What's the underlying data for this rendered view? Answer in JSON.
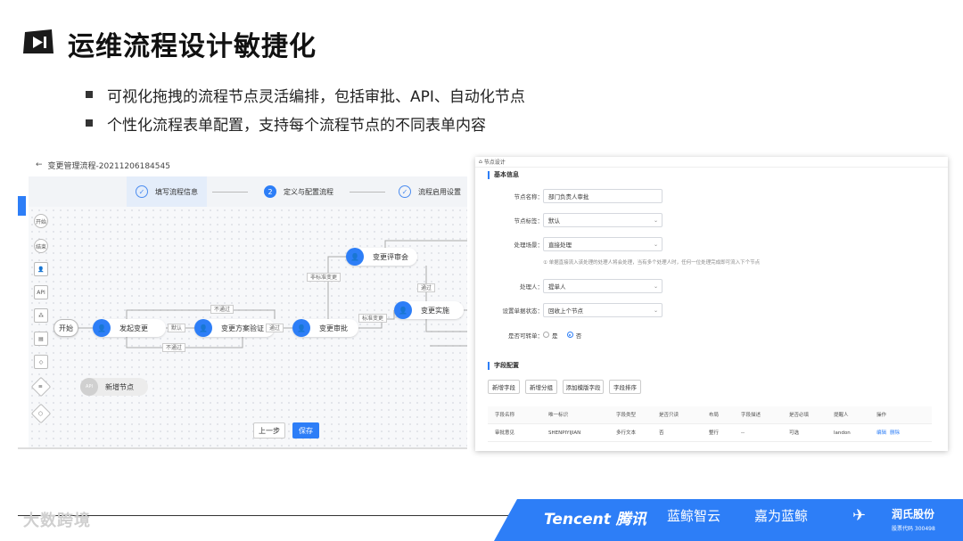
{
  "slide": {
    "title": "运维流程设计敏捷化",
    "bullets": [
      "可视化拖拽的流程节点灵活编排，包括审批、API、自动化节点",
      "个性化流程表单配置，支持每个流程节点的不同表单内容"
    ]
  },
  "flow_editor": {
    "header": "变更管理流程-20211206184545",
    "steps": [
      {
        "num": "✓",
        "label": "填写流程信息"
      },
      {
        "num": "2",
        "label": "定义与配置流程"
      },
      {
        "num": "✓",
        "label": "流程启用设置"
      }
    ],
    "palette": [
      "开始",
      "结束",
      "人",
      "API",
      "⁂",
      "▤",
      "◇",
      "≡",
      "◇"
    ],
    "nodes": {
      "start": "开始",
      "initiate": "发起变更",
      "verify": "变更方案验证",
      "approve": "变更审批",
      "review": "变更评审会",
      "implement": "变更实施"
    },
    "edge_labels": {
      "reject_top": "不通过",
      "default": "默认",
      "reject_bottom": "不通过",
      "pass1": "通过",
      "normal_change": "非标准变更",
      "pass2": "通过",
      "standard_change": "标准变更"
    },
    "new_node": {
      "badge": "API",
      "label": "新增节点"
    },
    "buttons": {
      "prev": "上一步",
      "save": "保存"
    }
  },
  "node_settings": {
    "breadcrumb": "节点设计",
    "section_basic": "基本信息",
    "fields": [
      {
        "label": "节点名称：",
        "value": "部门负责人审批",
        "type": "input"
      },
      {
        "label": "节点标签：",
        "value": "默认",
        "type": "select"
      },
      {
        "label": "处理场景：",
        "value": "直接处理",
        "type": "select"
      },
      {
        "label": "处理人：",
        "value": "提单人",
        "type": "select"
      },
      {
        "label": "设置单据状态：",
        "value": "回收上个节点",
        "type": "select"
      }
    ],
    "hint": "① 单据直接流入该处理的处理人将会处理，当有多个处理人时，任何一位处理完成即可流入下个节点",
    "transfer_label": "是否可转单：",
    "transfer_options": [
      {
        "label": "是",
        "on": false
      },
      {
        "label": "否",
        "on": true
      }
    ],
    "section_fields": "字段配置",
    "field_buttons": [
      "新增字段",
      "新增分组",
      "添加模版字段",
      "字段排序"
    ],
    "table": {
      "headers": [
        "字段名称",
        "唯一标识",
        "字段类型",
        "是否只读",
        "布局",
        "字段描述",
        "是否必填",
        "提醒人",
        "操作"
      ],
      "rows": [
        [
          "审批意见",
          "SHENPIYIJIAN",
          "多行文本",
          "否",
          "整行",
          "--",
          "可选",
          "landon",
          "编辑",
          "删除"
        ]
      ]
    }
  },
  "footer": {
    "watermark": "大数跨境",
    "brands": [
      "Tencent 腾讯",
      "蓝鲸智云",
      "嘉为蓝鲸",
      "润氏股份"
    ],
    "stock": "股票代码 300498"
  },
  "colors": {
    "accent": "#2d7ef7",
    "band": "#2d7ef7"
  }
}
